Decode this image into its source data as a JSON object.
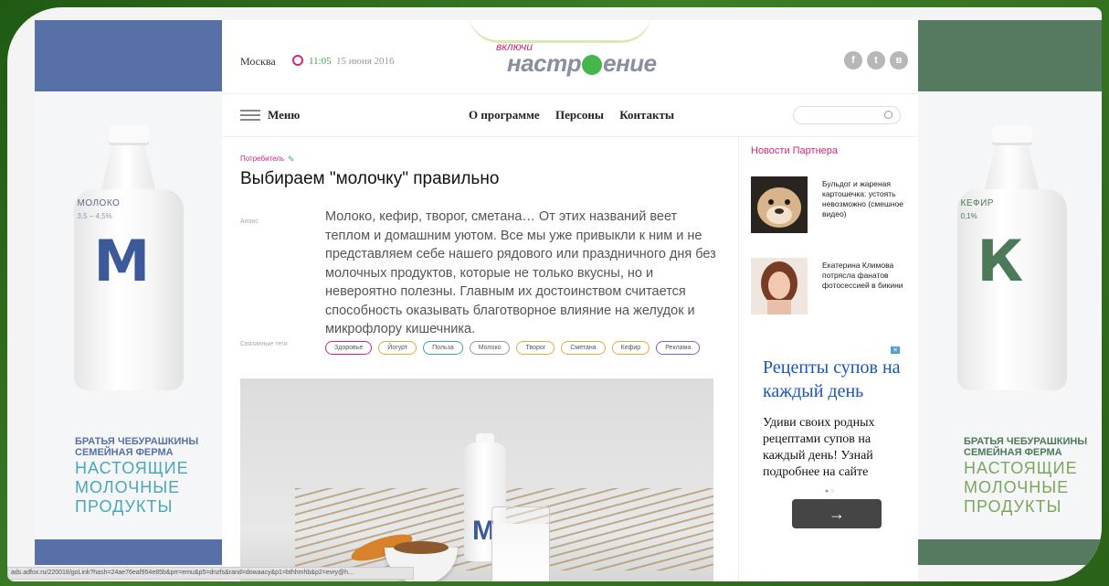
{
  "header": {
    "city": "Москва",
    "time": "11:05",
    "date": "15 июня 2016",
    "logo_small": "включи",
    "logo_part1": "настр",
    "logo_part2": "ение",
    "social": [
      "f",
      "t",
      "в"
    ]
  },
  "nav": {
    "menu_label": "Меню",
    "links": [
      "О программе",
      "Персоны",
      "Контакты"
    ],
    "search_placeholder": ""
  },
  "article": {
    "category": "Потребитель",
    "title": "Выбираем \"молочку\" правильно",
    "lead_label": "Анонс",
    "lead": "Молоко, кефир, творог, сметана… От этих названий веет теплом и домашним уютом. Все мы уже привыкли к ним и не представляем себе нашего рядового или праздничного дня без молочных продуктов, которые не только вкусны, но и невероятно полезны. Главным их достоинством считается способность оказывать благотворное влияние на желудок и микрофлору кишечника.",
    "tags_label": "Связанные теги",
    "tags": [
      "Здоровье",
      "Йогурт",
      "Польза",
      "Молоко",
      "Творог",
      "Сметана",
      "Кефир",
      "Реклама"
    ],
    "tag_colors": [
      "#d4267f",
      "#e6a93b",
      "#3aa9a4",
      "#999999",
      "#e6a93b",
      "#e6a93b",
      "#e6a93b",
      "#8e5bc8"
    ]
  },
  "sidebar": {
    "partner_title": "Новости Партнера",
    "news": [
      {
        "text": "Бульдог и жареная картошечка: устоять невозможно (смешное видео)"
      },
      {
        "text": "Екатерина Климова потрясла фанатов фотосессией в бикини"
      }
    ],
    "ad": {
      "title": "Рецепты супов на каждый день",
      "body": "Удиви своих родных рецептами супов на каждый день! Узнай подробнее на сайте",
      "close": "✕",
      "dots": "● ○",
      "button": "→"
    }
  },
  "left_ad": {
    "bottle_label": "МОЛОКО",
    "bottle_pct": "3,5 – 4,5%",
    "bottle_letter": "М",
    "brand_line1": "БРАТЬЯ ЧЕБУРАШКИНЫ",
    "brand_line2": "СЕМЕЙНАЯ ФЕРМА",
    "slogan": "НАСТОЯЩИЕ МОЛОЧНЫЕ ПРОДУКТЫ"
  },
  "right_ad": {
    "bottle_label": "КЕФИР",
    "bottle_pct": "0,1%",
    "bottle_letter": "К",
    "brand_line1": "БРАТЬЯ ЧЕБУРАШКИНЫ",
    "brand_line2": "СЕМЕЙНАЯ ФЕРМА",
    "slogan": "НАСТОЯЩИЕ МОЛОЧНЫЕ ПРОДУКТЫ"
  },
  "status_url": "ads.adfox.ru/220018/goLink?hash=24ae76eaf954e85b&prr=emu&p5=dnzfs&rand=dowaacy&p1=bthhmhb&p2=evry@h..."
}
